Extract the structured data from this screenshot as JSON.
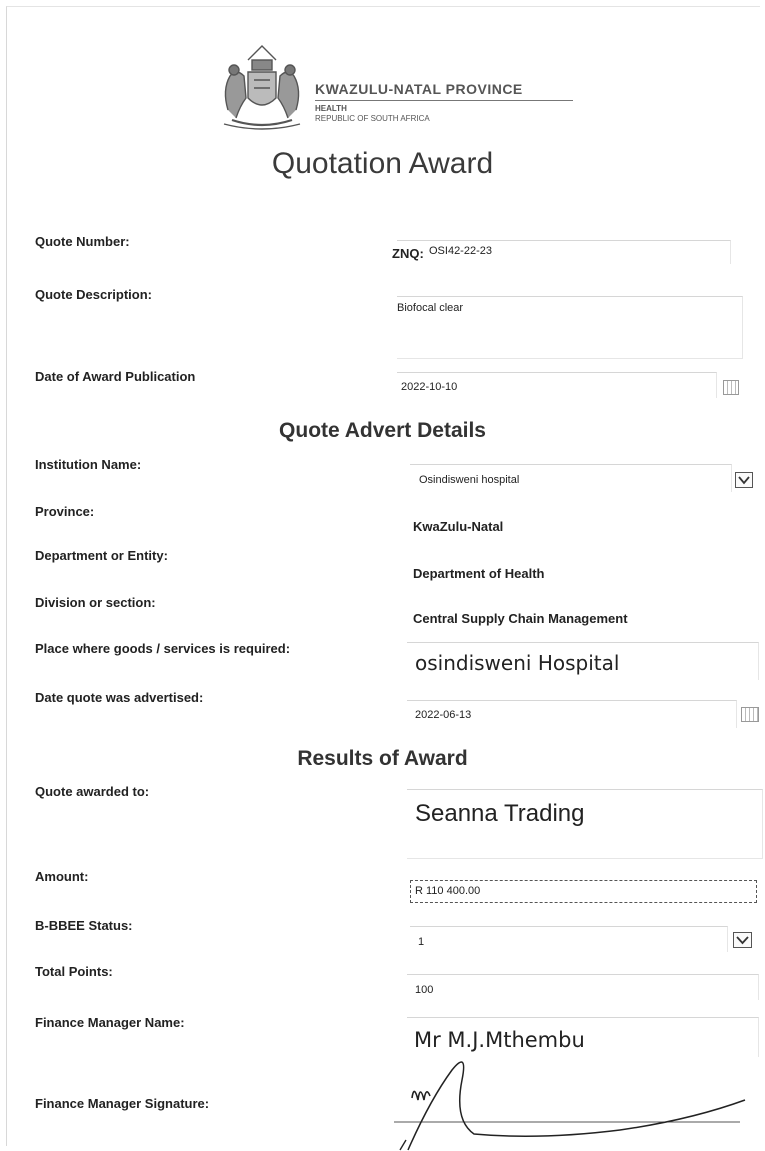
{
  "header": {
    "org_name": "KWAZULU-NATAL PROVINCE",
    "org_sub1": "HEALTH",
    "org_sub2": "REPUBLIC OF SOUTH AFRICA"
  },
  "title": "Quotation Award",
  "quote": {
    "number_label": "Quote Number:",
    "number_prefix": "ZNQ:",
    "number_value": "OSI42-22-23",
    "description_label": "Quote Description:",
    "description_value": "Biofocal clear",
    "publication_label": "Date of Award Publication",
    "publication_value": "2022-10-10"
  },
  "advert": {
    "heading": "Quote Advert Details",
    "institution_label": "Institution Name:",
    "institution_value": "Osindisweni hospital",
    "province_label": "Province:",
    "province_value": "KwaZulu-Natal",
    "department_label": "Department or Entity:",
    "department_value": "Department of Health",
    "division_label": "Division or section:",
    "division_value": "Central Supply Chain Management",
    "place_label": "Place where goods /  services is required:",
    "place_value": "osindisweni Hospital",
    "advertised_label": "Date quote was advertised:",
    "advertised_value": "2022-06-13"
  },
  "results": {
    "heading": "Results of Award",
    "awarded_label": "Quote awarded to:",
    "awarded_value": "Seanna Trading",
    "amount_label": "Amount:",
    "amount_value": "R 110 400.00",
    "bbbee_label": "B-BBEE Status:",
    "bbbee_value": "1",
    "points_label": "Total Points:",
    "points_value": "100",
    "manager_label": "Finance Manager Name:",
    "manager_value": "Mr M.J.Mthembu",
    "signature_label": "Finance Manager Signature:"
  },
  "icons": {
    "crest": "provincial-crest-icon",
    "calendar": "calendar-icon",
    "dropdown": "chevron-down-icon",
    "signature": "handwritten-signature"
  }
}
